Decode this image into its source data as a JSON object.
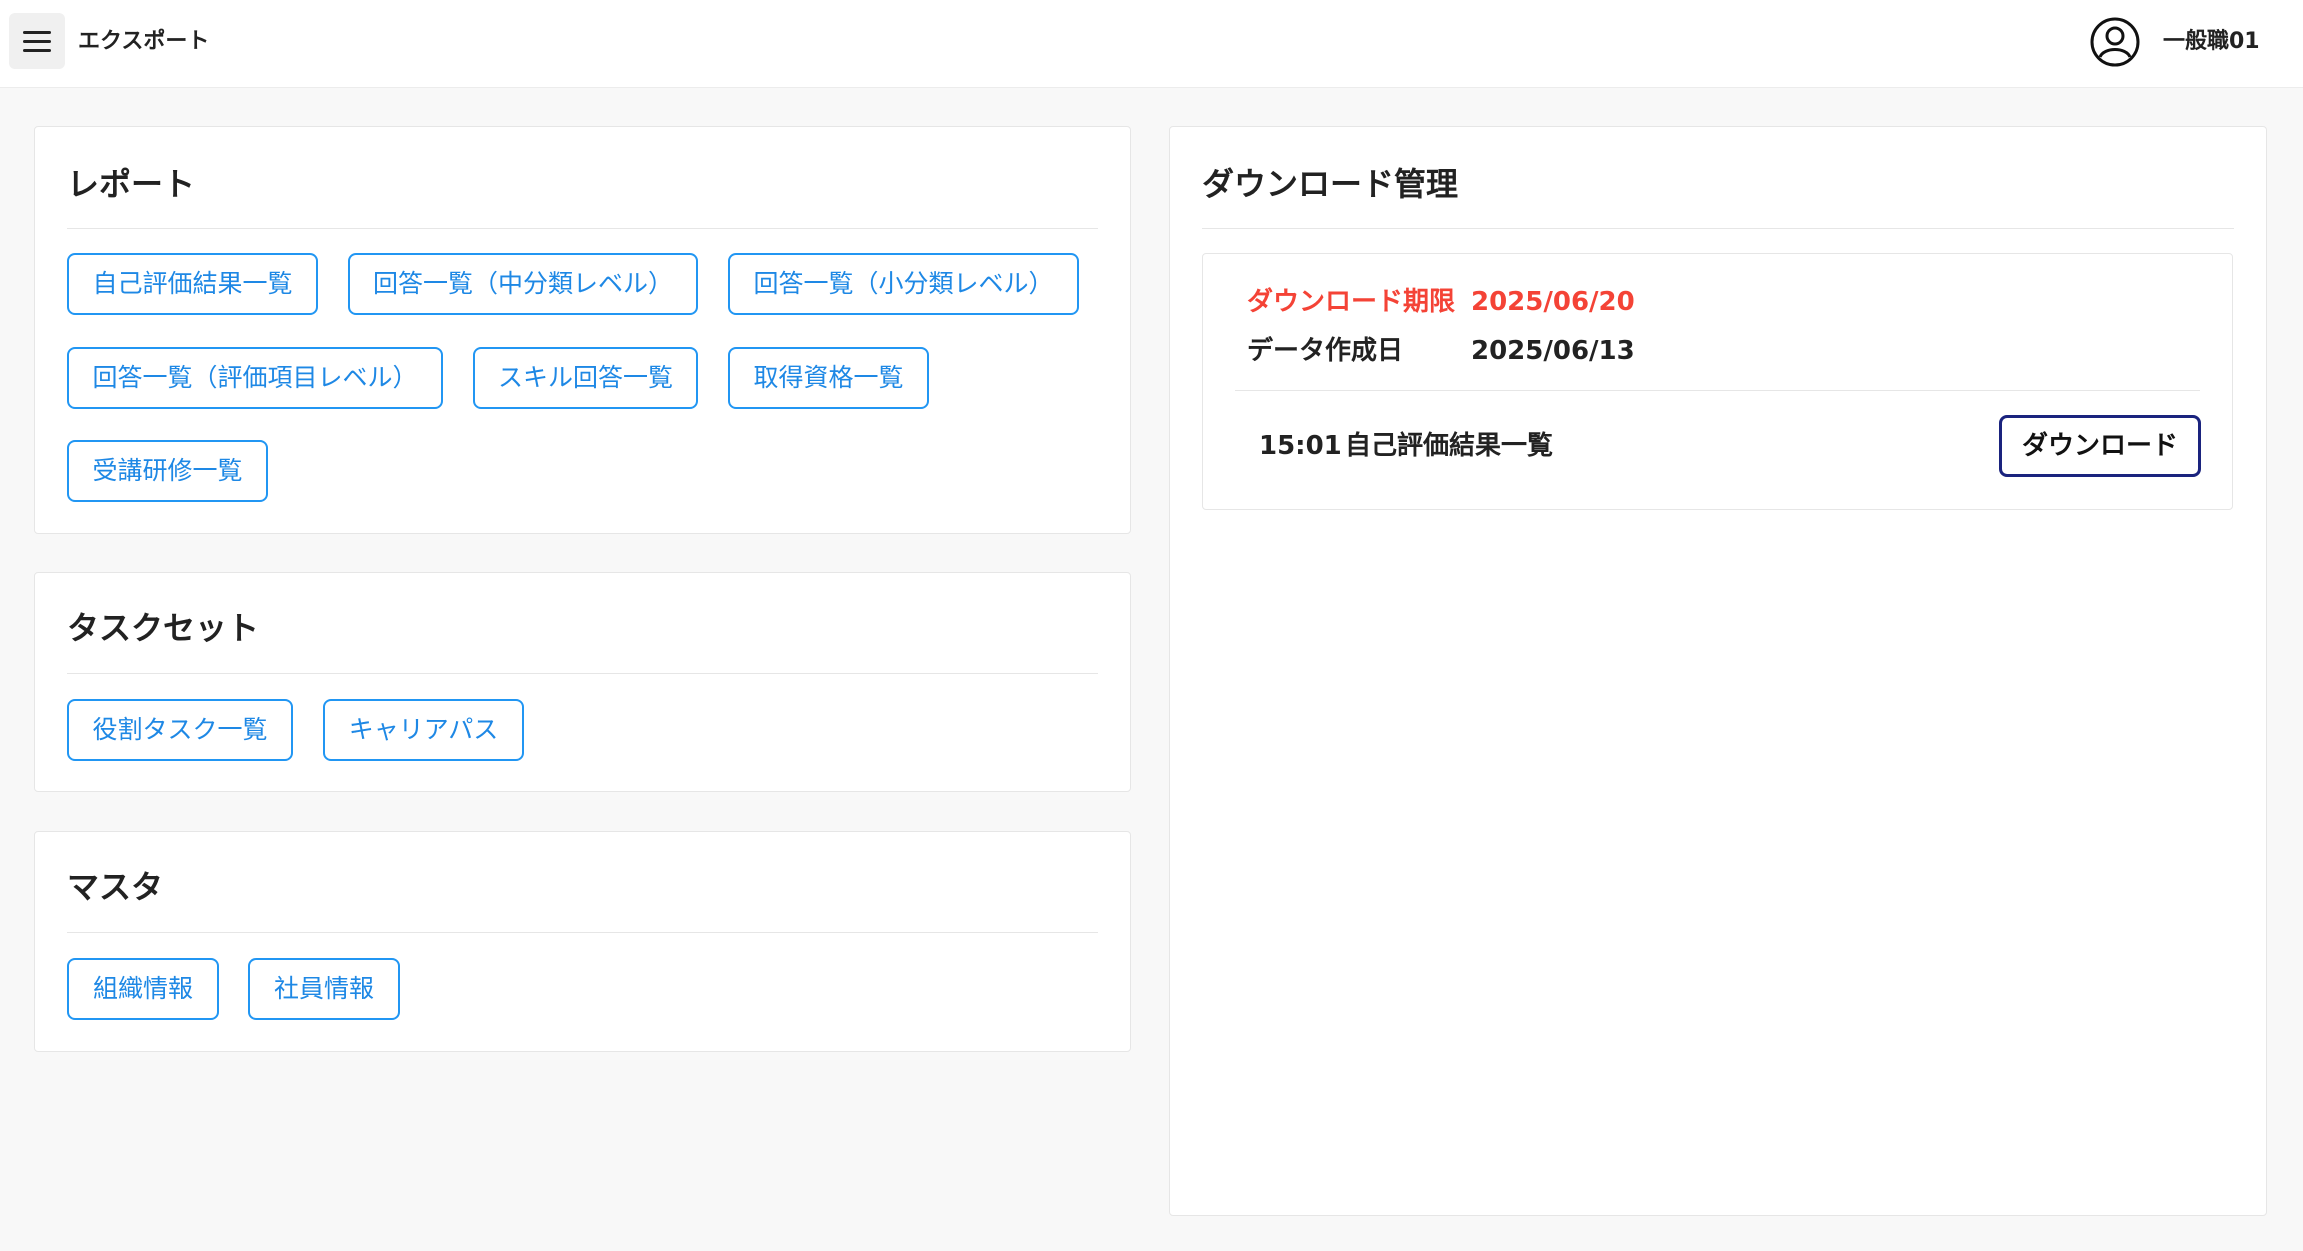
{
  "header": {
    "title": "エクスポート",
    "user_name": "一般職01",
    "menu_icon": "hamburger-menu-icon",
    "avatar_icon": "user-circle-icon"
  },
  "report": {
    "title": "レポート",
    "buttons": [
      "自己評価結果一覧",
      "回答一覧（中分類レベル）",
      "回答一覧（小分類レベル）",
      "回答一覧（評価項目レベル）",
      "スキル回答一覧",
      "取得資格一覧",
      "受講研修一覧"
    ]
  },
  "taskset": {
    "title": "タスクセット",
    "buttons": [
      "役割タスク一覧",
      "キャリアパス"
    ]
  },
  "master": {
    "title": "マスタ",
    "buttons": [
      "組織情報",
      "社員情報"
    ]
  },
  "download": {
    "title": "ダウンロード管理",
    "deadline_label": "ダウンロード期限",
    "deadline_value": "2025/06/20",
    "created_label": "データ作成日",
    "created_value": "2025/06/13",
    "item_time": "15:01",
    "item_name": "自己評価結果一覧",
    "button_label": "ダウンロード"
  },
  "colors": {
    "accent": "#2196f3",
    "warning": "#f44336",
    "dark_button_border": "#1a237e"
  }
}
